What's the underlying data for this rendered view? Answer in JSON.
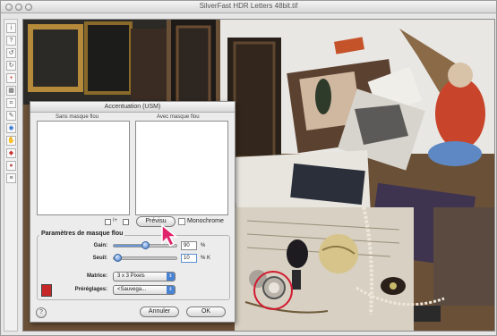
{
  "window": {
    "title": "SilverFast HDR Letters 48bit.tif"
  },
  "toolbar": {
    "icons": [
      "info-icon",
      "question-icon",
      "rotate-left-icon",
      "rotate-right-icon",
      "crosshair-icon",
      "grid-icon",
      "crop-icon",
      "pipette-icon",
      "zoom-icon",
      "hand-icon",
      "color-icon",
      "palette-icon",
      "layers-icon"
    ]
  },
  "dialog": {
    "title": "Accentuation (USM)",
    "before_label": "Sans masque flou",
    "after_label": "Avec masque flou",
    "preview_button": "Prévisu",
    "monochrome_label": "Monochrome",
    "group_title": "Paramètres de masque flou",
    "gain": {
      "label": "Gain:",
      "value": "90",
      "unit": "%",
      "level": 0.5
    },
    "threshold": {
      "label": "Seuil:",
      "value": "10",
      "unit": "% K",
      "level": 0.08
    },
    "matrix": {
      "label": "Matrice:",
      "selected": "3 x 3 Pixels"
    },
    "presets": {
      "label": "Préréglages:",
      "selected": "<Sauvega..."
    },
    "cancel_button": "Annuler",
    "ok_button": "OK",
    "help_button": "?"
  },
  "colors": {
    "accent": "#d21a2f",
    "slider": "#3a72c4"
  }
}
